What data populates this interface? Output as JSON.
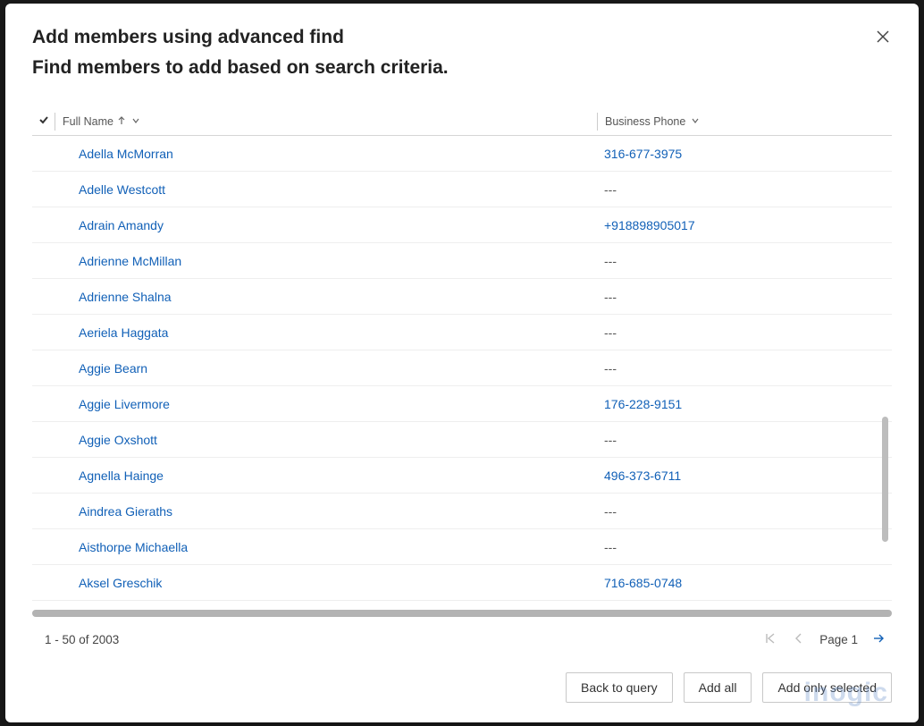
{
  "header": {
    "title": "Add members using advanced find",
    "subtitle": "Find members to add based on search criteria."
  },
  "columns": {
    "name": "Full Name",
    "phone": "Business Phone"
  },
  "rows": [
    {
      "name": "Adella McMorran",
      "phone": "316-677-3975",
      "phone_is_link": true
    },
    {
      "name": "Adelle Westcott",
      "phone": "---",
      "phone_is_link": false
    },
    {
      "name": "Adrain Amandy",
      "phone": "+918898905017",
      "phone_is_link": true
    },
    {
      "name": "Adrienne McMillan",
      "phone": "---",
      "phone_is_link": false
    },
    {
      "name": "Adrienne Shalna",
      "phone": "---",
      "phone_is_link": false
    },
    {
      "name": "Aeriela Haggata",
      "phone": "---",
      "phone_is_link": false
    },
    {
      "name": "Aggie Bearn",
      "phone": "---",
      "phone_is_link": false
    },
    {
      "name": "Aggie Livermore",
      "phone": "176-228-9151",
      "phone_is_link": true
    },
    {
      "name": "Aggie Oxshott",
      "phone": "---",
      "phone_is_link": false
    },
    {
      "name": "Agnella Hainge",
      "phone": "496-373-6711",
      "phone_is_link": true
    },
    {
      "name": "Aindrea Gieraths",
      "phone": "---",
      "phone_is_link": false
    },
    {
      "name": "Aisthorpe Michaella",
      "phone": "---",
      "phone_is_link": false
    },
    {
      "name": "Aksel Greschik",
      "phone": "716-685-0748",
      "phone_is_link": true
    }
  ],
  "pager": {
    "range": "1 - 50 of 2003",
    "page_label": "Page 1"
  },
  "footer": {
    "back": "Back to query",
    "add_all": "Add all",
    "add_selected": "Add only selected"
  },
  "watermark": "inogic"
}
